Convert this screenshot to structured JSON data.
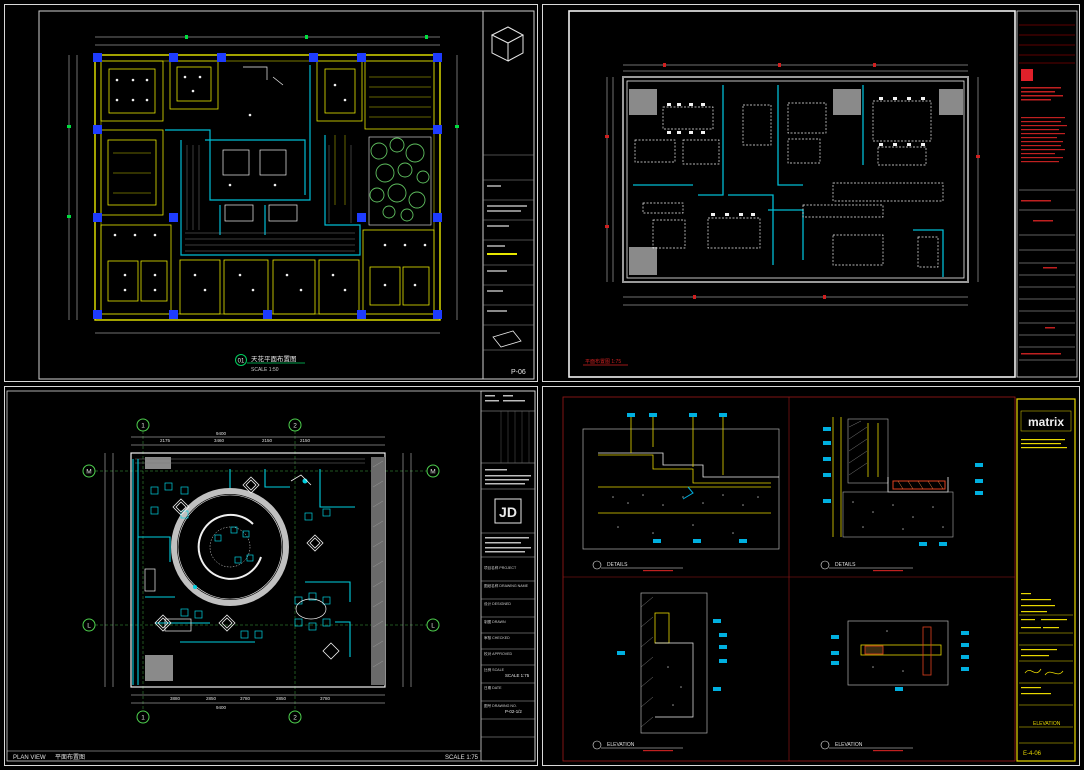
{
  "panels": {
    "p1": {
      "plan_title": "天花平面布置图",
      "title_badge": "01",
      "scale_text": "SCALE 1:50",
      "sheet_no": "P-06"
    },
    "p2": {
      "plan_title": "平面布置图 1:75"
    },
    "p3": {
      "plan_view_label": "PLAN VIEW",
      "plan_name": "平面布置图",
      "scale_label": "SCALE 1:75",
      "grid_bubbles": [
        "1",
        "2",
        "M",
        "L"
      ],
      "dims_top": [
        "2175",
        "3460",
        "2150",
        "2150"
      ],
      "dims_bottom": [
        "3880",
        "2850",
        "3780",
        "2850",
        "3780"
      ],
      "overall_width": "9400",
      "logo_mark": "JD",
      "title_block": {
        "rows": [
          "项目名称 PROJECT",
          "图纸名称 DRAWING NAME",
          "设计 DESIGNED",
          "制图 DRAWN",
          "审核 CHECKED",
          "校对 APPROVED",
          "比例 SCALE",
          "日期 DATE",
          "图号 DRAWING NO."
        ],
        "scale_value": "SCALE 1:75",
        "drawing_no": "P-02-1/2"
      }
    },
    "p4": {
      "brand": "matrix",
      "captions": [
        "DETAILS",
        "DETAILS",
        "ELEVATION",
        "ELEVATION"
      ],
      "elevation_label": "ELEVATION",
      "sheet_no": "E-4-06"
    }
  }
}
